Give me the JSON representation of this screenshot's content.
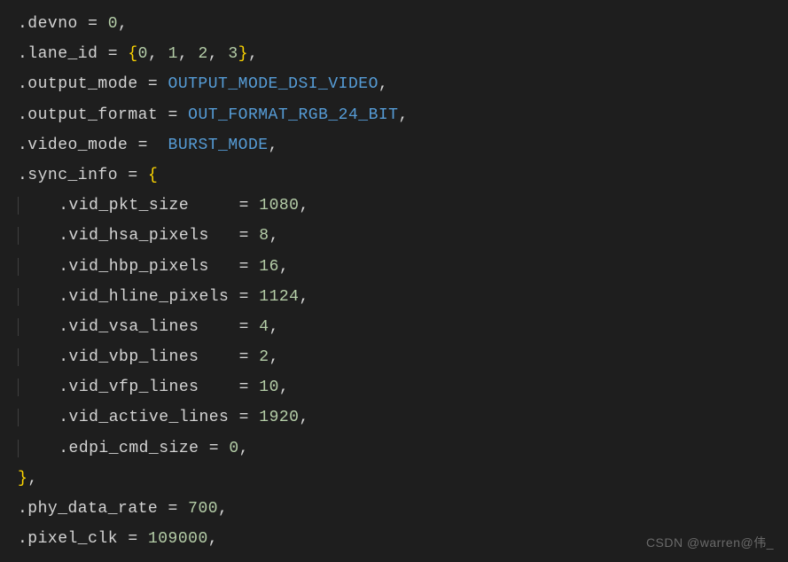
{
  "code": {
    "devno_label": ".devno",
    "devno_val": "0",
    "lane_id_label": ".lane_id",
    "lane_id_v0": "0",
    "lane_id_v1": "1",
    "lane_id_v2": "2",
    "lane_id_v3": "3",
    "output_mode_label": ".output_mode",
    "output_mode_val": "OUTPUT_MODE_DSI_VIDEO",
    "output_format_label": ".output_format",
    "output_format_val": "OUT_FORMAT_RGB_24_BIT",
    "video_mode_label": ".video_mode",
    "video_mode_val": "BURST_MODE",
    "sync_info_label": ".sync_info",
    "vid_pkt_size_label": ".vid_pkt_size",
    "vid_pkt_size_val": "1080",
    "vid_hsa_pixels_label": ".vid_hsa_pixels",
    "vid_hsa_pixels_val": "8",
    "vid_hbp_pixels_label": ".vid_hbp_pixels",
    "vid_hbp_pixels_val": "16",
    "vid_hline_pixels_label": ".vid_hline_pixels",
    "vid_hline_pixels_val": "1124",
    "vid_vsa_lines_label": ".vid_vsa_lines",
    "vid_vsa_lines_val": "4",
    "vid_vbp_lines_label": ".vid_vbp_lines",
    "vid_vbp_lines_val": "2",
    "vid_vfp_lines_label": ".vid_vfp_lines",
    "vid_vfp_lines_val": "10",
    "vid_active_lines_label": ".vid_active_lines",
    "vid_active_lines_val": "1920",
    "edpi_cmd_size_label": ".edpi_cmd_size",
    "edpi_cmd_size_val": "0",
    "phy_data_rate_label": ".phy_data_rate",
    "phy_data_rate_val": "700",
    "pixel_clk_label": ".pixel_clk",
    "pixel_clk_val": "109000"
  },
  "watermark": "CSDN @warren@伟_"
}
